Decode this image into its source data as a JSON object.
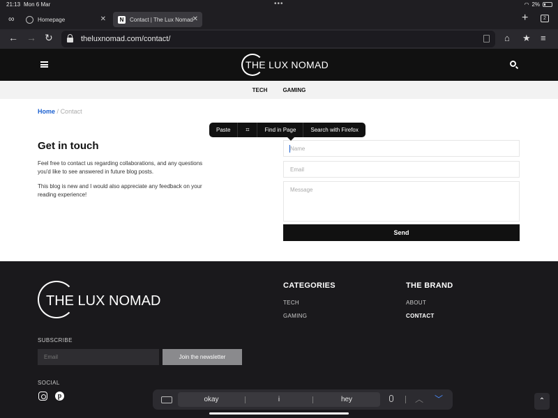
{
  "status": {
    "time": "21:13",
    "date": "Mon 6 Mar",
    "battery": "2%"
  },
  "tabs": [
    {
      "title": "Homepage"
    },
    {
      "title": "Contact | The Lux Nomad",
      "favicon": "N"
    }
  ],
  "tab_count": "2",
  "url": "theluxnomad.com/contact/",
  "site": {
    "brand": "THE LUX NOMAD",
    "nav": [
      "TECH",
      "GAMING"
    ]
  },
  "breadcrumb": {
    "home": "Home",
    "sep": "/",
    "current": "Contact"
  },
  "context_menu": {
    "paste": "Paste",
    "find": "Find in Page",
    "search": "Search with Firefox"
  },
  "contact": {
    "heading": "Get in touch",
    "p1": "Feel free to contact us regarding collaborations, and any questions you'd like to see answered in future blog posts.",
    "p2": "This blog is new and I would also appreciate any feedback on your reading experience!",
    "name_placeholder": "Name",
    "email_placeholder": "Email",
    "message_placeholder": "Message",
    "send": "Send"
  },
  "footer": {
    "brand": "THE LUX NOMAD",
    "categories_head": "CATEGORIES",
    "categories": [
      "TECH",
      "GAMING"
    ],
    "brand_head": "THE BRAND",
    "brand_links": [
      "ABOUT",
      "CONTACT"
    ],
    "subscribe_head": "SUBSCRIBE",
    "subscribe_placeholder": "Email",
    "join": "Join the newsletter",
    "social_head": "SOCIAL"
  },
  "keyboard": {
    "suggestions": [
      "okay",
      "i",
      "hey"
    ]
  },
  "colors": {
    "accent": "#1a5fd0",
    "dark": "#111111",
    "footer_bg": "#1a191c"
  }
}
